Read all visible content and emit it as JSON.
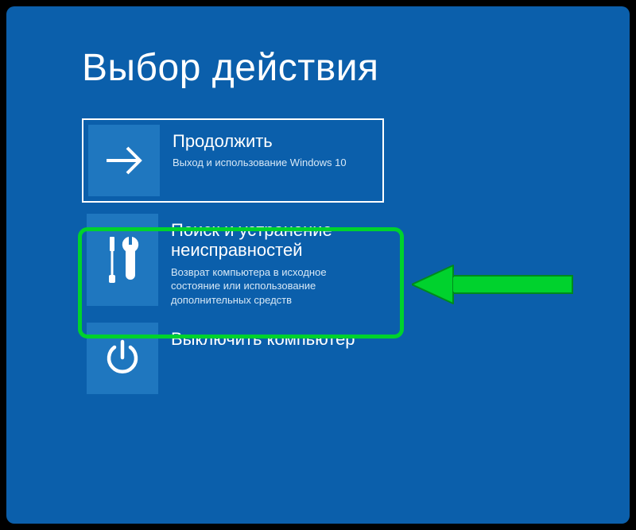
{
  "page": {
    "title": "Выбор действия"
  },
  "tiles": {
    "continue": {
      "title": "Продолжить",
      "subtitle": "Выход и использование Windows 10"
    },
    "troubleshoot": {
      "title": "Поиск и устранение неисправностей",
      "subtitle": "Возврат компьютера в исходное состояние или использование дополнительных средств"
    },
    "shutdown": {
      "title": "Выключить компьютер",
      "subtitle": ""
    }
  },
  "colors": {
    "background": "#0b5fab",
    "tile_icon_bg": "#1f77bf",
    "highlight": "#00d22d",
    "text": "#ffffff"
  }
}
